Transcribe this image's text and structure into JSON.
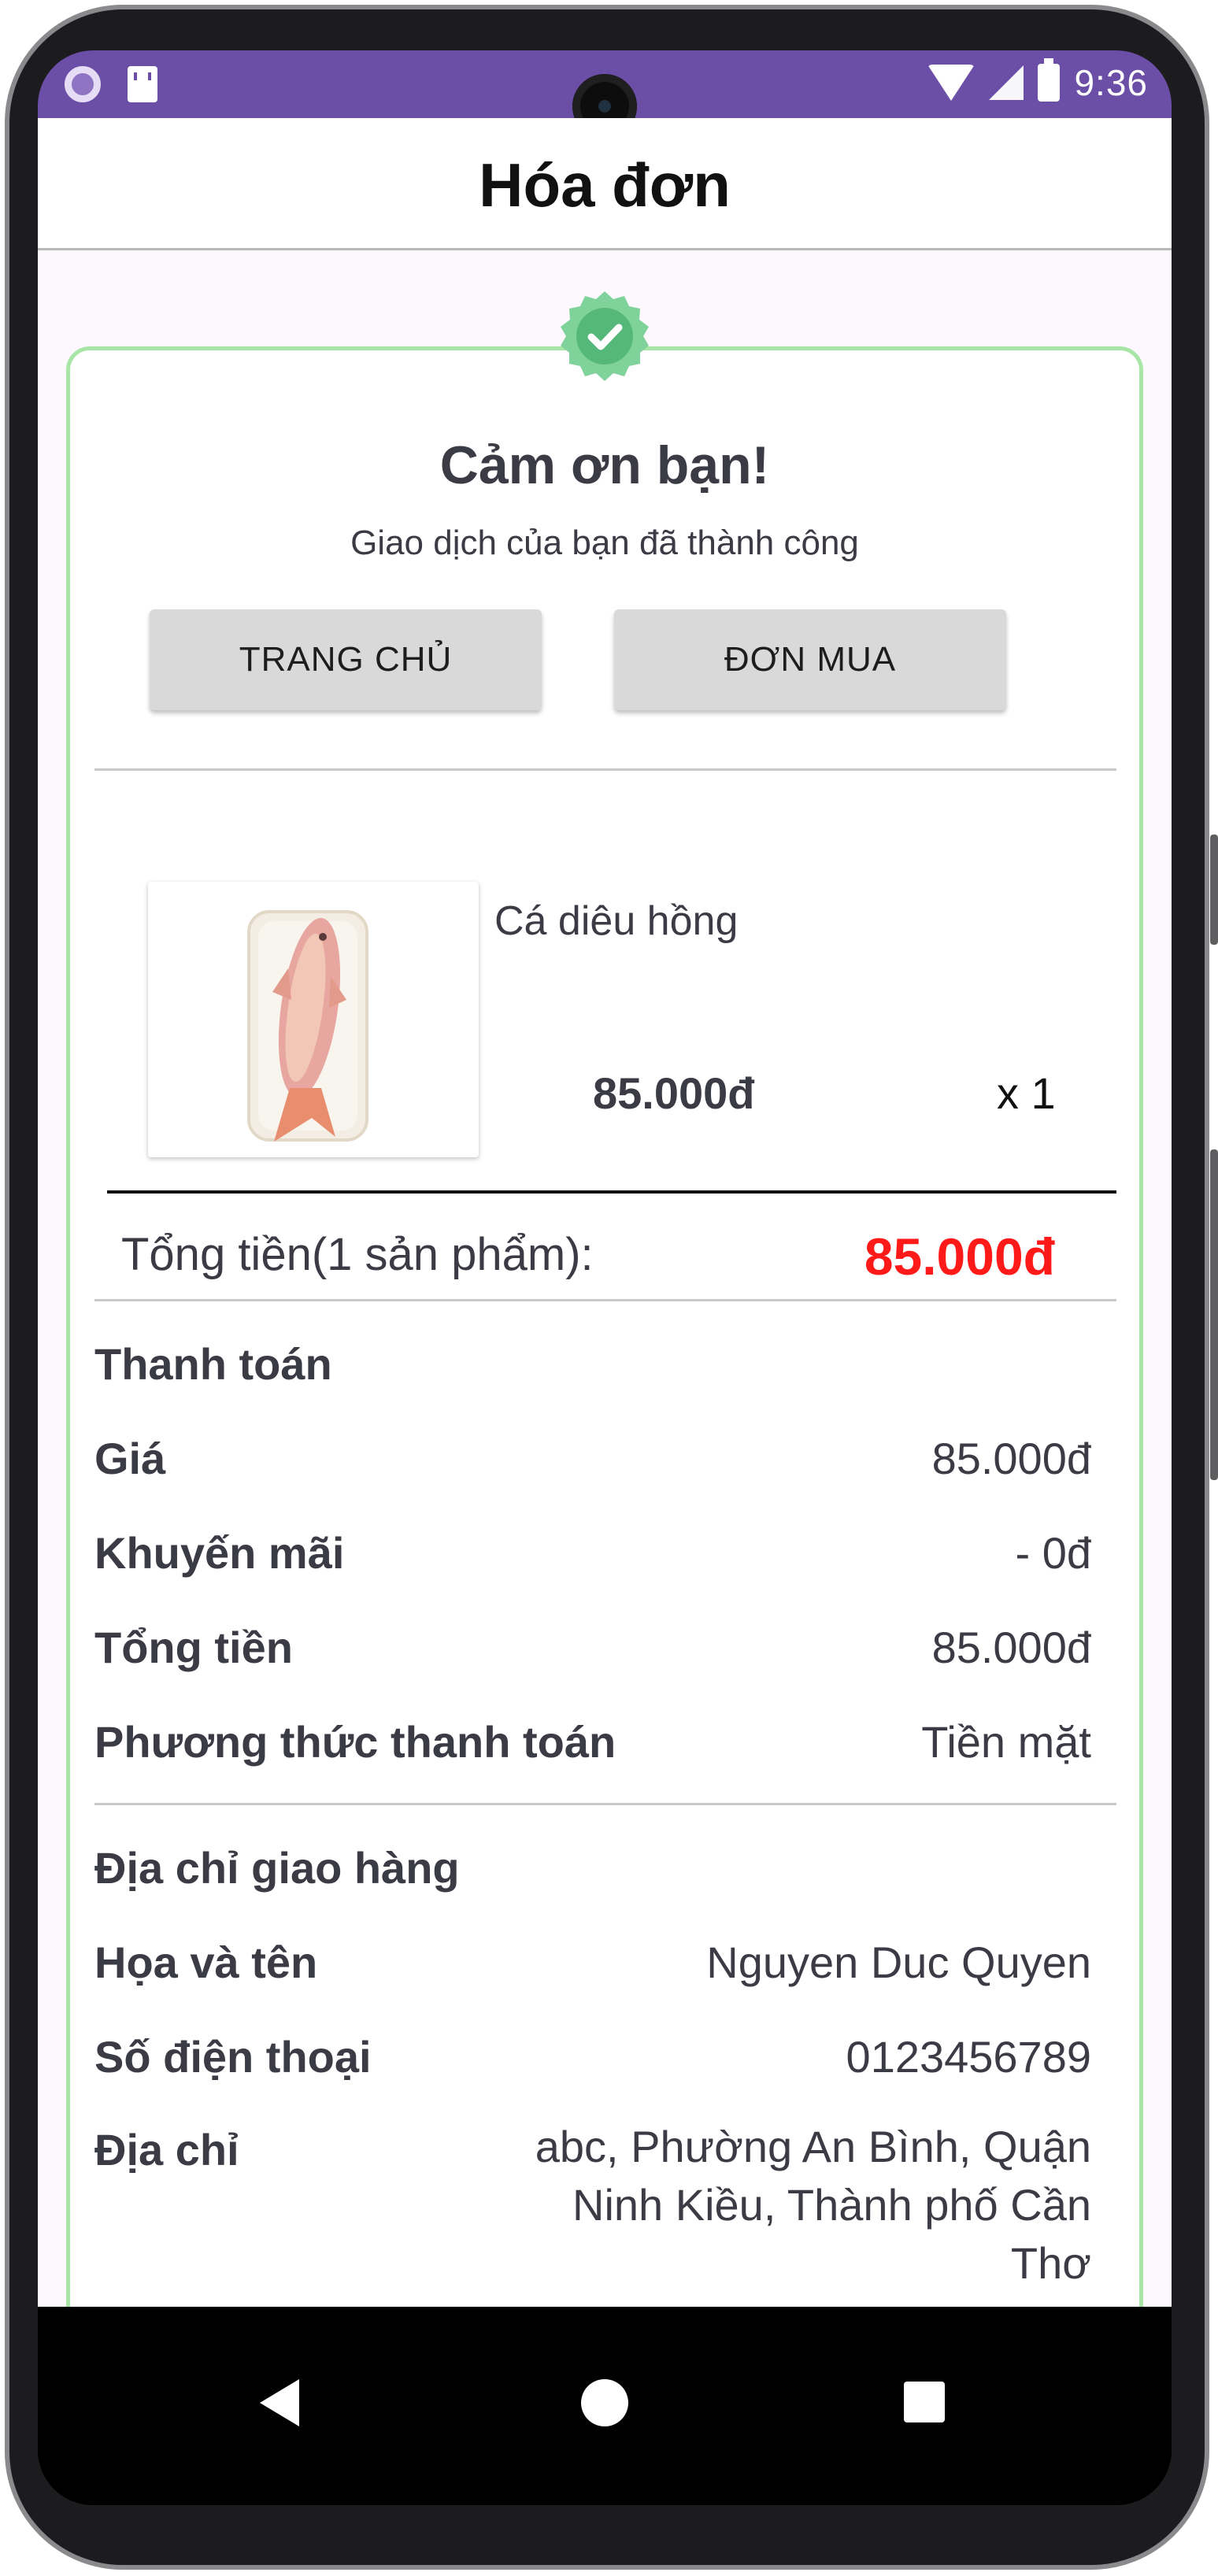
{
  "status_bar": {
    "time": "9:36"
  },
  "header": {
    "title": "Hóa đơn"
  },
  "success": {
    "title": "Cảm ơn bạn!",
    "subtitle": "Giao dịch của bạn đã thành công"
  },
  "actions": {
    "home_label": "TRANG CHỦ",
    "orders_label": "ĐƠN MUA"
  },
  "product": {
    "name": "Cá diêu hồng",
    "price": "85.000đ",
    "quantity": "x 1"
  },
  "order_total": {
    "label": "Tổng tiền(1 sản phẩm):",
    "value": "85.000đ"
  },
  "payment": {
    "section_title": "Thanh toán",
    "price_label": "Giá",
    "price_value": "85.000đ",
    "discount_label": "Khuyến mãi",
    "discount_value": "- 0đ",
    "total_label": "Tổng tiền",
    "total_value": "85.000đ",
    "method_label": "Phương thức thanh toán",
    "method_value": "Tiền mặt"
  },
  "shipping": {
    "section_title": "Địa chỉ giao hàng",
    "name_label": "Họa và tên",
    "name_value": "Nguyen Duc Quyen",
    "phone_label": "Số điện thoại",
    "phone_value": "0123456789",
    "address_label": "Địa chỉ",
    "address_value": "abc, Phường An Bình, Quận Ninh Kiều, Thành phố Cần Thơ"
  },
  "colors": {
    "status_bar": "#6b4ea6",
    "card_border": "#a8e6a8",
    "badge": "#7fd39a",
    "total_value": "#ff1a1a",
    "background": "#fdf7fe"
  },
  "icons": [
    "status-circle-icon",
    "sd-card-icon",
    "wifi-icon",
    "signal-icon",
    "battery-icon",
    "check-badge-icon",
    "back-icon",
    "home-icon",
    "recents-icon"
  ]
}
